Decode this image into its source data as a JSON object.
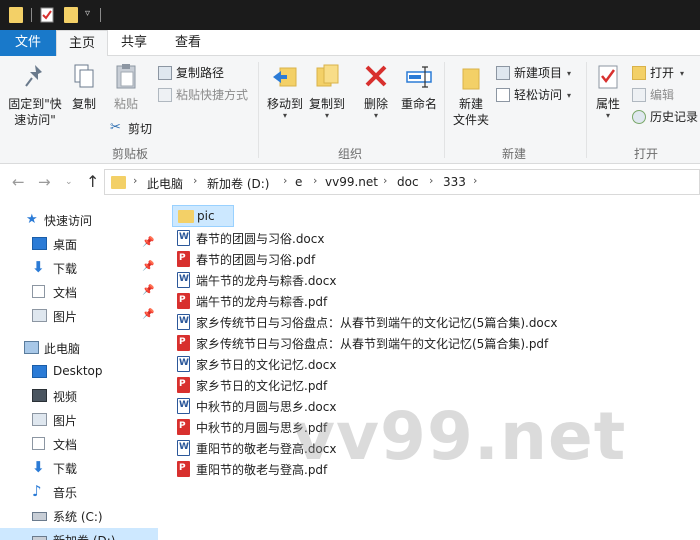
{
  "colors": {
    "accent": "#1979ca",
    "folder": "#f3d067",
    "selection": "#cce8ff",
    "pdf": "#d8302e",
    "word": "#2b579a"
  },
  "ribbon_tabs": {
    "file": "文件",
    "home": "主页",
    "share": "共享",
    "view": "查看"
  },
  "clipboard": {
    "pin": "固定到\"快\n速访问\"",
    "copy": "复制",
    "paste": "粘贴",
    "copy_path": "复制路径",
    "paste_shortcut": "粘贴快捷方式",
    "cut": "剪切",
    "group": "剪贴板"
  },
  "organize": {
    "move_to": "移动到",
    "copy_to": "复制到",
    "delete": "删除",
    "rename": "重命名",
    "group": "组织"
  },
  "new": {
    "new_folder": "新建\n文件夹",
    "new_item": "新建项目",
    "easy_access": "轻松访问",
    "group": "新建"
  },
  "open": {
    "properties": "属性",
    "open": "打开",
    "edit": "编辑",
    "history": "历史记录",
    "group": "打开"
  },
  "address": {
    "crumbs": [
      "此电脑",
      "新加卷 (D:)",
      "e",
      "vv99.net",
      "doc",
      "333"
    ]
  },
  "nav": {
    "quick_access": "快速访问",
    "quick": [
      "桌面",
      "下载",
      "文档",
      "图片"
    ],
    "this_pc": "此电脑",
    "pc": [
      "Desktop",
      "视频",
      "图片",
      "文档",
      "下载",
      "音乐",
      "系统 (C:)",
      "新加卷 (D:)"
    ]
  },
  "files": [
    {
      "name": "pic",
      "type": "folder"
    },
    {
      "name": "春节的团圆与习俗.docx",
      "type": "word"
    },
    {
      "name": "春节的团圆与习俗.pdf",
      "type": "pdf"
    },
    {
      "name": "端午节的龙舟与粽香.docx",
      "type": "word"
    },
    {
      "name": "端午节的龙舟与粽香.pdf",
      "type": "pdf"
    },
    {
      "name": "家乡传统节日与习俗盘点：从春节到端午的文化记忆(5篇合集).docx",
      "type": "word"
    },
    {
      "name": "家乡传统节日与习俗盘点：从春节到端午的文化记忆(5篇合集).pdf",
      "type": "pdf"
    },
    {
      "name": "家乡节日的文化记忆.docx",
      "type": "word"
    },
    {
      "name": "家乡节日的文化记忆.pdf",
      "type": "pdf"
    },
    {
      "name": "中秋节的月圆与思乡.docx",
      "type": "word"
    },
    {
      "name": "中秋节的月圆与思乡.pdf",
      "type": "pdf"
    },
    {
      "name": "重阳节的敬老与登高.docx",
      "type": "word"
    },
    {
      "name": "重阳节的敬老与登高.pdf",
      "type": "pdf"
    }
  ],
  "watermark": "vv99.net"
}
